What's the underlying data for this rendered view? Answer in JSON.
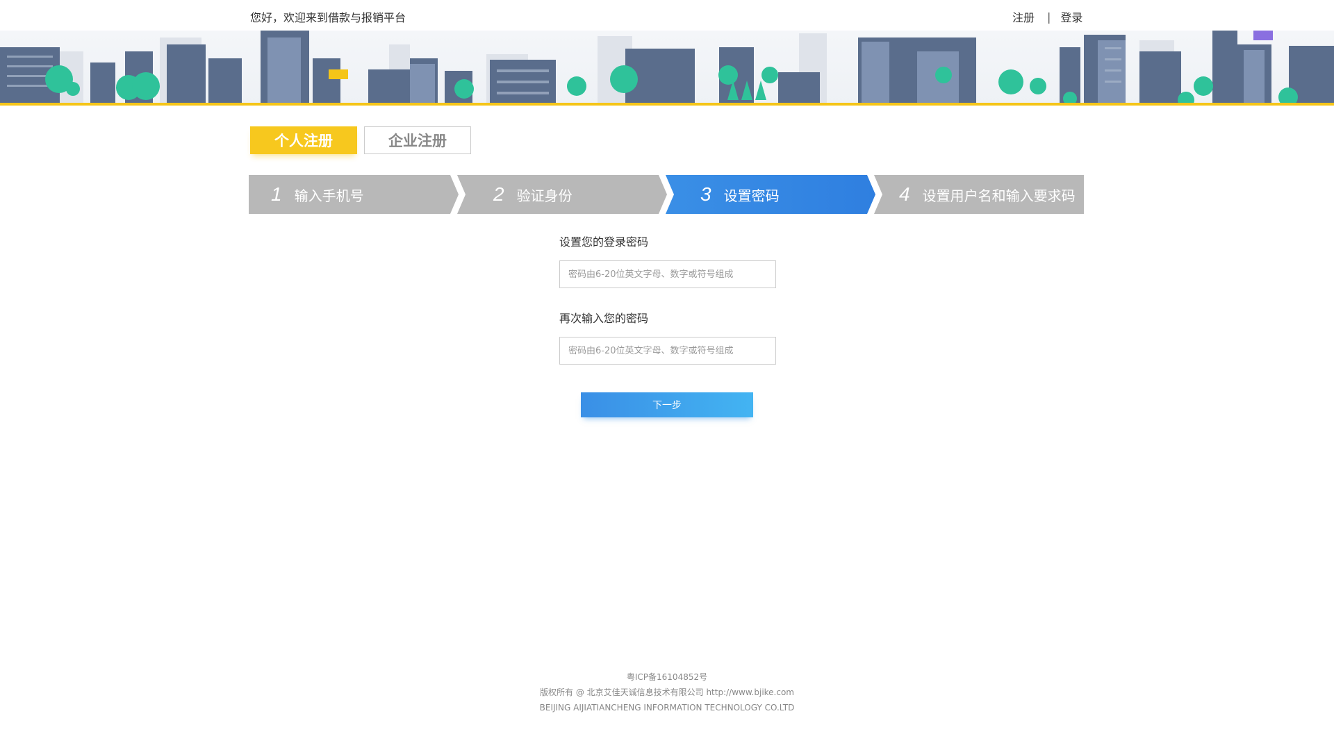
{
  "header": {
    "welcome": "您好，欢迎来到借款与报销平台",
    "register_link": "注册",
    "separator": "|",
    "login_link": "登录"
  },
  "tabs": [
    {
      "label": "个人注册",
      "active": true
    },
    {
      "label": "企业注册",
      "active": false
    }
  ],
  "steps": [
    {
      "num": "1",
      "label": "输入手机号",
      "active": false
    },
    {
      "num": "2",
      "label": "验证身份",
      "active": false
    },
    {
      "num": "3",
      "label": "设置密码",
      "active": true
    },
    {
      "num": "4",
      "label": "设置用户名和输入要求码",
      "active": false
    }
  ],
  "form": {
    "password_label": "设置您的登录密码",
    "password_placeholder": "密码由6-20位英文字母、数字或符号组成",
    "confirm_label": "再次输入您的密码",
    "confirm_placeholder": "密码由6-20位英文字母、数字或符号组成",
    "next_button": "下一步"
  },
  "footer": {
    "icp": "粤ICP备16104852号",
    "copyright": "版权所有 @ 北京艾佳天诚信息技术有限公司 http://www.bjike.com",
    "company_en": "BEIJING AIJIATIANCHENG INFORMATION TECHNOLOGY CO.LTD"
  },
  "colors": {
    "accent_yellow": "#f7c81e",
    "active_step_blue": "#3a8fe6",
    "inactive_step_gray": "#b8b8b8",
    "button_blue": "#43b4f2"
  }
}
